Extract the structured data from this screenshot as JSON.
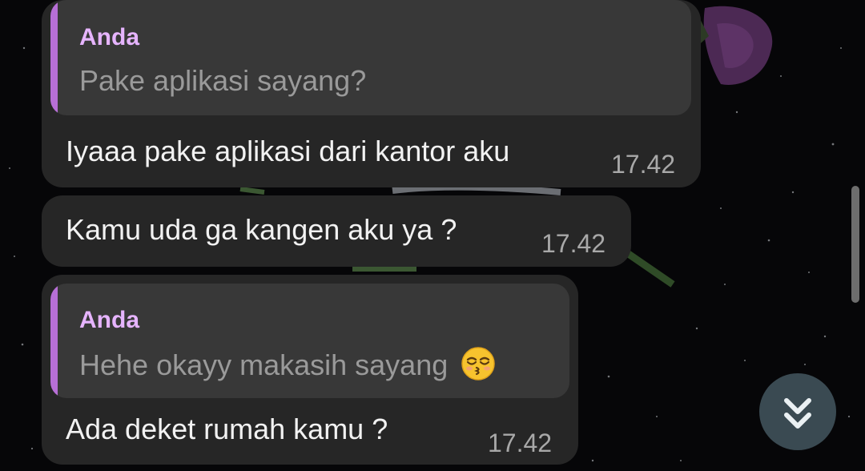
{
  "messages": [
    {
      "reply_to": {
        "sender": "Anda",
        "text": "Pake aplikasi sayang?"
      },
      "text": "Iyaaa pake aplikasi dari kantor aku",
      "time": "17.42"
    },
    {
      "text": "Kamu uda ga kangen aku ya ?",
      "time": "17.42"
    },
    {
      "reply_to": {
        "sender": "Anda",
        "text": "Hehe okayy makasih sayang",
        "emoji": "kissing-face-closed-eyes"
      },
      "text": "Ada deket rumah kamu ?",
      "time": "17.42"
    }
  ],
  "scroll_down_button": {
    "icon": "double-chevron-down-icon"
  },
  "colors": {
    "bubble": "#262626",
    "quote_background": "#383838",
    "quote_accent": "#b76fd6",
    "quote_sender": "#e6b4ff",
    "message_text": "#f2f2f2",
    "timestamp": "#a8a8a8",
    "fab": "#3a4a52"
  }
}
